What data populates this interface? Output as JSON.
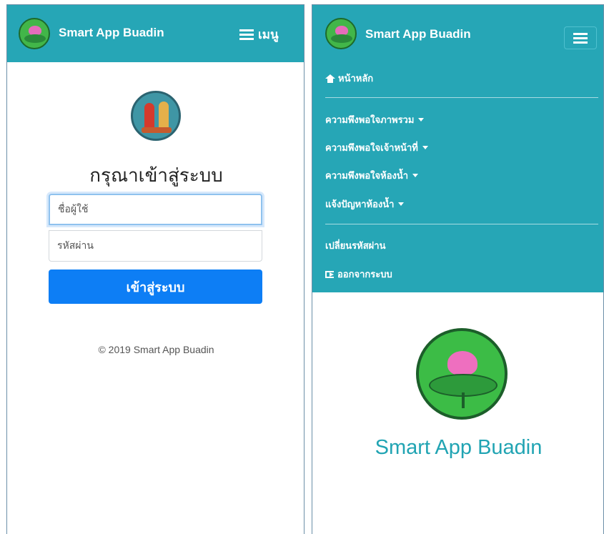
{
  "left": {
    "navbar": {
      "brand": "Smart App Buadin",
      "menu_label": "เมนู"
    },
    "login": {
      "title": "กรุณาเข้าสู่ระบบ",
      "username_placeholder": "ชื่อผู้ใช้",
      "password_placeholder": "รหัสผ่าน",
      "submit_label": "เข้าสู่ระบบ"
    },
    "footer": {
      "copyright": "© 2019 Smart App Buadin"
    }
  },
  "right": {
    "navbar": {
      "brand": "Smart App Buadin"
    },
    "menu": {
      "home": "หน้าหลัก",
      "dropdowns": [
        "ความพึงพอใจภาพรวม",
        "ความพึงพอใจเจ้าหน้าที่",
        "ความพึงพอใจห้องน้ำ",
        "แจ้งปัญหาห้องน้ำ"
      ],
      "change_password": "เปลี่ยนรหัสผ่าน",
      "logout": "ออกจากระบบ"
    },
    "main": {
      "title": "Smart App Buadin"
    }
  },
  "colors": {
    "navbar": "#26a6b6",
    "primary_button": "#0d7ef5",
    "title_teal": "#21a4b3"
  },
  "icons": [
    "logo-icon",
    "hamburger-icon",
    "home-icon",
    "caret-down-icon",
    "logout-icon",
    "seal-icon"
  ]
}
